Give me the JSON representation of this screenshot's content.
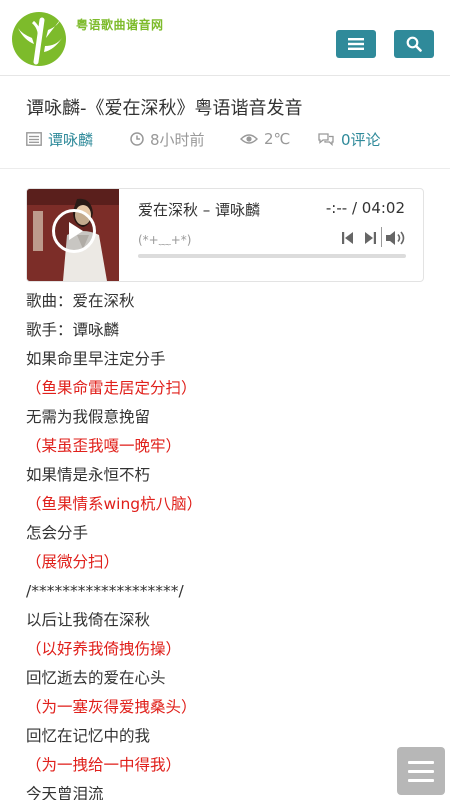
{
  "site": {
    "name": "粤语歌曲谐音网",
    "accent": "#2f8a9a",
    "logo_color": "#7dbb2b"
  },
  "header": {
    "menu_icon": "menu-icon",
    "search_icon": "search-icon"
  },
  "article": {
    "title": "谭咏麟-《爱在深秋》粤语谐音发音",
    "author": "谭咏麟",
    "time": "8小时前",
    "weather": "2℃",
    "comments": "0评论"
  },
  "player": {
    "song": "爱在深秋 – 谭咏麟",
    "time": "-:-- / 04:02",
    "subtitle": "(*+﹏+*)",
    "progress": 0
  },
  "lyrics": [
    {
      "text": "歌曲：爱在深秋",
      "type": "normal"
    },
    {
      "text": "歌手：谭咏麟",
      "type": "normal"
    },
    {
      "text": "如果命里早注定分手",
      "type": "normal"
    },
    {
      "text": "（鱼果命雷走居定分扫）",
      "type": "red"
    },
    {
      "text": "无需为我假意挽留",
      "type": "normal"
    },
    {
      "text": "（某虽歪我嘎一晚牢）",
      "type": "red"
    },
    {
      "text": "如果情是永恒不朽",
      "type": "normal"
    },
    {
      "text": "（鱼果情系wing杭八脑）",
      "type": "red"
    },
    {
      "text": "怎会分手",
      "type": "normal"
    },
    {
      "text": "（展微分扫）",
      "type": "red"
    },
    {
      "text": "/*******************/",
      "type": "normal"
    },
    {
      "text": "以后让我倚在深秋",
      "type": "normal"
    },
    {
      "text": "（以好养我倚拽伤操）",
      "type": "red"
    },
    {
      "text": "回忆逝去的爱在心头",
      "type": "normal"
    },
    {
      "text": "（为一塞灰得爱拽桑头）",
      "type": "red"
    },
    {
      "text": "回忆在记忆中的我",
      "type": "normal"
    },
    {
      "text": "（为一拽给一中得我）",
      "type": "red"
    },
    {
      "text": "今天曾泪流",
      "type": "normal"
    }
  ]
}
